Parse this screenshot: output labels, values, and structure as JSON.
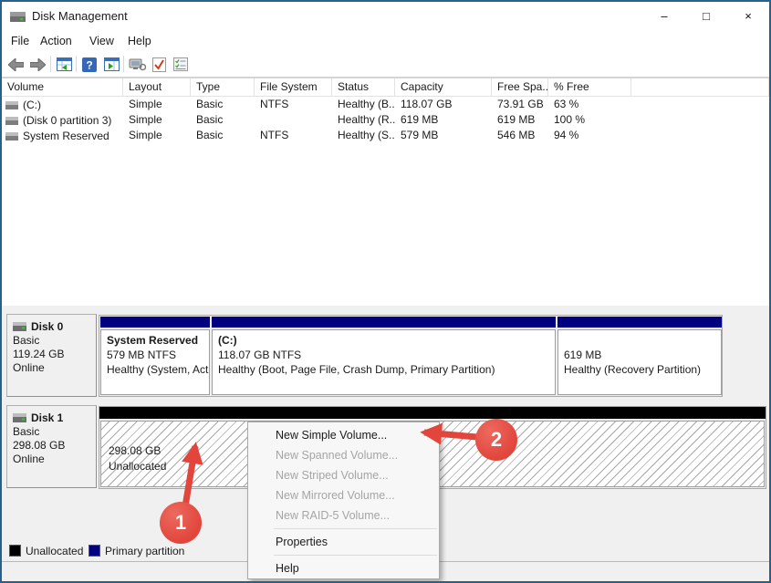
{
  "window": {
    "title": "Disk Management",
    "controls": {
      "minimize": "–",
      "maximize": "□",
      "close": "×"
    }
  },
  "menu_bar": [
    "File",
    "Action",
    "View",
    "Help"
  ],
  "toolbar_icons": [
    "back-icon",
    "forward-icon",
    "console-tree-icon",
    "help-icon",
    "action-pane-icon",
    "monitor-icon",
    "checkmark-icon",
    "checklist-icon"
  ],
  "volume_table": {
    "columns": [
      "Volume",
      "Layout",
      "Type",
      "File System",
      "Status",
      "Capacity",
      "Free Spa...",
      "% Free"
    ],
    "rows": [
      {
        "volume": "(C:)",
        "layout": "Simple",
        "type": "Basic",
        "fs": "NTFS",
        "status": "Healthy (B...",
        "capacity": "118.07 GB",
        "free": "73.91 GB",
        "pct": "63 %"
      },
      {
        "volume": "(Disk 0 partition 3)",
        "layout": "Simple",
        "type": "Basic",
        "fs": "",
        "status": "Healthy (R...",
        "capacity": "619 MB",
        "free": "619 MB",
        "pct": "100 %"
      },
      {
        "volume": "System Reserved",
        "layout": "Simple",
        "type": "Basic",
        "fs": "NTFS",
        "status": "Healthy (S...",
        "capacity": "579 MB",
        "free": "546 MB",
        "pct": "94 %"
      }
    ]
  },
  "disks": [
    {
      "name": "Disk 0",
      "type": "Basic",
      "size": "119.24 GB",
      "status": "Online",
      "partitions": [
        {
          "title": "System Reserved",
          "info": "579 MB NTFS",
          "health": "Healthy (System, Active, Prima"
        },
        {
          "title": "(C:)",
          "info": "118.07 GB NTFS",
          "health": "Healthy (Boot, Page File, Crash Dump, Primary Partition)"
        },
        {
          "title": "",
          "info": "619 MB",
          "health": "Healthy (Recovery Partition)"
        }
      ]
    },
    {
      "name": "Disk 1",
      "type": "Basic",
      "size": "298.08 GB",
      "status": "Online",
      "unallocated": {
        "size": "298.08 GB",
        "label": "Unallocated"
      }
    }
  ],
  "context_menu": {
    "items": [
      {
        "label": "New Simple Volume...",
        "enabled": true
      },
      {
        "label": "New Spanned Volume...",
        "enabled": false
      },
      {
        "label": "New Striped Volume...",
        "enabled": false
      },
      {
        "label": "New Mirrored Volume...",
        "enabled": false
      },
      {
        "label": "New RAID-5 Volume...",
        "enabled": false
      },
      {
        "label": "Properties",
        "enabled": true
      },
      {
        "label": "Help",
        "enabled": true
      }
    ]
  },
  "legend": [
    {
      "label": "Unallocated",
      "color": "#000000"
    },
    {
      "label": "Primary partition",
      "color": "#000080"
    }
  ],
  "annotations": {
    "step1": {
      "number": "1"
    },
    "step2": {
      "number": "2"
    },
    "accent_color": "#e2453c"
  },
  "colors": {
    "primary_partition": "#000080",
    "unallocated": "#000000",
    "window_border": "#24618c"
  }
}
